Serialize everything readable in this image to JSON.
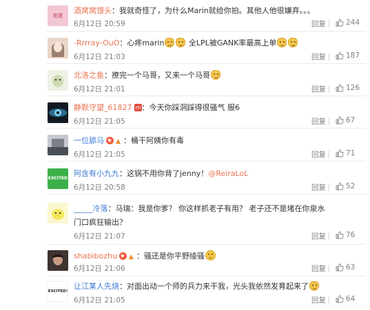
{
  "comments": [
    {
      "user": "酒窝窝馒头",
      "text": "：我就奇怪了，为什么Marin就给你拍。其他人他很嫌弃。。。",
      "time": "6月12日 20:59",
      "likes": "244",
      "reply": "回复",
      "avatar_color": "#f3c6d3",
      "avatar_label": "吃货"
    },
    {
      "user": "-Rrrray-OuO",
      "text": "：心疼marin",
      "text2": " 全LPL被GANK率最高上单",
      "time": "6月12日 21:03",
      "likes": "187",
      "reply": "回复",
      "avatar_color": "#c8a58c",
      "avatar_label": ""
    },
    {
      "user": "北洛之鱼",
      "text": "：撩完一个马哥，又来一个马哥",
      "time": "6月12日 21:01",
      "likes": "126",
      "reply": "回复",
      "avatar_color": "#dfe8c9",
      "avatar_label": ""
    },
    {
      "user": "静默守望_61827",
      "text": "：今天你踩洞踩得很骚气 服6",
      "time": "6月12日 21:05",
      "likes": "67",
      "reply": "回复",
      "avatar_color": "#1a2530",
      "avatar_label": ""
    },
    {
      "user": "一位舔马",
      "text": "：桶干阿姨你有毒",
      "time": "6月12日 21:05",
      "likes": "71",
      "reply": "回复",
      "avatar_color": "#9aa0a8",
      "avatar_label": ""
    },
    {
      "user": "阿含有小九九",
      "text": "：这锅不用你背了jenny！",
      "mention": "@ReiraLoL",
      "time": "6月12日 20:58",
      "likes": "52",
      "reply": "回复",
      "avatar_color": "#3bb04a",
      "avatar_label": "EXCITED"
    },
    {
      "user": "_____冷落",
      "text": "：马瑞：我是你爹？ 你这样抓老子有用？ 老子还不是堵在你泉水门口疯狂输出？",
      "time": "6月12日 21:07",
      "likes": "76",
      "reply": "回复",
      "avatar_color": "#f4ef7a",
      "avatar_label": ""
    },
    {
      "user": "shabibozhu",
      "text": "：骚还是你平野绫骚",
      "time": "6月12日 21:06",
      "likes": "63",
      "reply": "回复",
      "avatar_color": "#5a4a44",
      "avatar_label": ""
    },
    {
      "user": "让江某人先烧",
      "text": "：对面出动一个师的兵力来干我，光头我依然发育起来了",
      "time": "6月12日 21:05",
      "likes": "64",
      "reply": "回复",
      "avatar_color": "#ffffff",
      "avatar_label": "EXCITED!"
    }
  ]
}
